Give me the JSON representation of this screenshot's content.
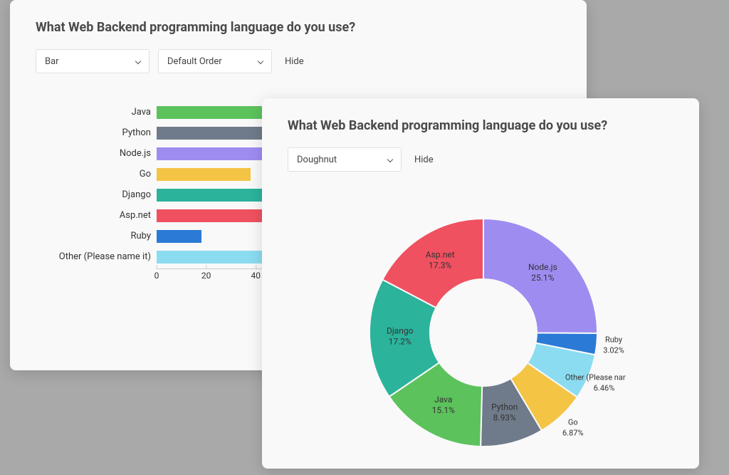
{
  "cards": {
    "left": {
      "title": "What Web Backend programming language do you use?",
      "controls": {
        "chart_type": "Bar",
        "order": "Default Order",
        "hide": "Hide"
      }
    },
    "right": {
      "title": "What Web Backend programming language do you use?",
      "controls": {
        "chart_type": "Doughnut",
        "hide": "Hide"
      }
    }
  },
  "chart_data": [
    {
      "type": "bar",
      "orientation": "horizontal",
      "title": "What Web Backend programming language do you use?",
      "categories": [
        "Java",
        "Python",
        "Node.js",
        "Go",
        "Django",
        "Asp.net",
        "Ruby",
        "Other (Please name it)"
      ],
      "values": [
        56,
        56,
        56,
        38,
        56,
        56,
        18,
        47
      ],
      "colors": [
        "#5cc25c",
        "#6f7b8a",
        "#9f8cf0",
        "#f4c444",
        "#2bb39b",
        "#ef5160",
        "#2a7ad6",
        "#8bdcf0"
      ],
      "xlabel": "",
      "ylabel": "",
      "xlim": [
        0,
        56
      ],
      "xticks": [
        0,
        20,
        40
      ]
    },
    {
      "type": "pie",
      "subtype": "doughnut",
      "title": "What Web Backend programming language do you use?",
      "series": [
        {
          "name": "Node.js",
          "value": 25.1,
          "label": "25.1%",
          "color": "#9f8cf0"
        },
        {
          "name": "Ruby",
          "value": 3.02,
          "label": "3.02%",
          "color": "#2a7ad6"
        },
        {
          "name": "Other (Please name it)",
          "value": 6.46,
          "label": "6.46%",
          "color": "#8bdcf0"
        },
        {
          "name": "Go",
          "value": 6.87,
          "label": "6.87%",
          "color": "#f4c444"
        },
        {
          "name": "Python",
          "value": 8.93,
          "label": "8.93%",
          "color": "#6f7b8a"
        },
        {
          "name": "Java",
          "value": 15.1,
          "label": "15.1%",
          "color": "#5cc25c"
        },
        {
          "name": "Django",
          "value": 17.2,
          "label": "17.2%",
          "color": "#2bb39b"
        },
        {
          "name": "Asp.net",
          "value": 17.3,
          "label": "17.3%",
          "color": "#ef5160"
        }
      ]
    }
  ]
}
